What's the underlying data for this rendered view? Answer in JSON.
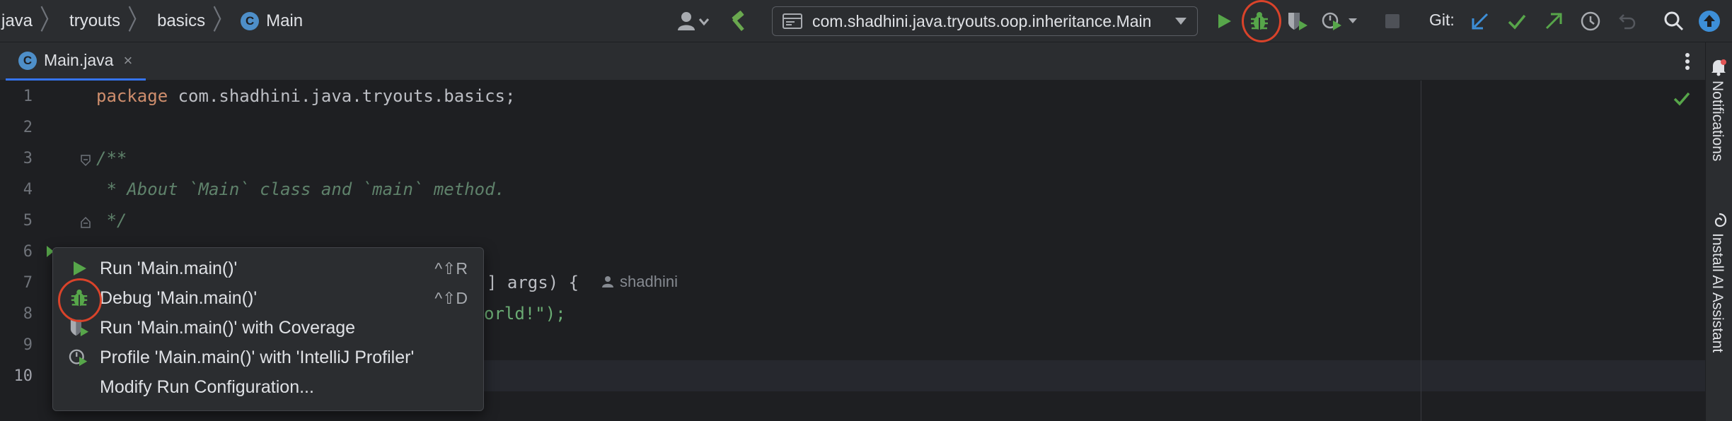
{
  "breadcrumbs": [
    "java",
    "tryouts",
    "basics",
    "Main"
  ],
  "run_config": {
    "label": "com.shadhini.java.tryouts.oop.inheritance.Main"
  },
  "git": {
    "label": "Git:"
  },
  "tab": {
    "label": "Main.java",
    "close": "×"
  },
  "right_strip": {
    "notifications": "Notifications",
    "ai_assistant": "Install AI Assistant"
  },
  "editor": {
    "line_numbers": [
      "1",
      "2",
      "3",
      "4",
      "5",
      "6",
      "7",
      "8",
      "9",
      "10"
    ],
    "lines": {
      "l1_kw": "package",
      "l1_rest": " com.shadhini.java.tryouts.basics;",
      "l3": "/**",
      "l4": " * About `Main` class and `main` method.",
      "l5": " */",
      "l7_tail": "] args) {",
      "l8_tail": "orld!\");"
    },
    "author": "shadhini"
  },
  "popup": {
    "items": [
      {
        "label": "Run 'Main.main()'",
        "shortcut": "^⇧R",
        "icon": "run-icon"
      },
      {
        "label": "Debug 'Main.main()'",
        "shortcut": "^⇧D",
        "icon": "debug-icon"
      },
      {
        "label": "Run 'Main.main()' with Coverage",
        "shortcut": "",
        "icon": "coverage-icon"
      },
      {
        "label": "Profile 'Main.main()' with 'IntelliJ Profiler'",
        "shortcut": "",
        "icon": "profiler-icon"
      },
      {
        "label": "Modify Run Configuration...",
        "shortcut": "",
        "icon": ""
      }
    ]
  },
  "colors": {
    "accent": "#3574f0",
    "run_green": "#57a64a",
    "highlight_red": "#d9432a",
    "git_blue": "#3d8fd8",
    "keyword": "#cf8e6d",
    "doc_comment": "#5f826b"
  }
}
